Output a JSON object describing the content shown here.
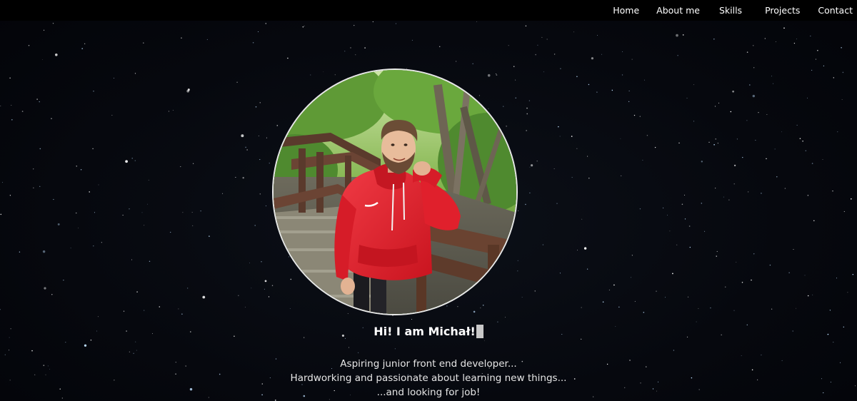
{
  "nav": {
    "items": [
      {
        "label": "Home"
      },
      {
        "label": "About me"
      },
      {
        "label": "Skills"
      },
      {
        "label": "Projects"
      },
      {
        "label": "Contact"
      }
    ]
  },
  "hero": {
    "greeting": "Hi! I am Michał!",
    "taglines": [
      "Aspiring junior front end developer...",
      "Hardworking and passionate about learning new things...",
      "...and looking for job!"
    ]
  },
  "colors": {
    "background": "#05070d",
    "navbar": "#000000",
    "text": "#ffffff",
    "hoodie": "#e11d2a"
  }
}
